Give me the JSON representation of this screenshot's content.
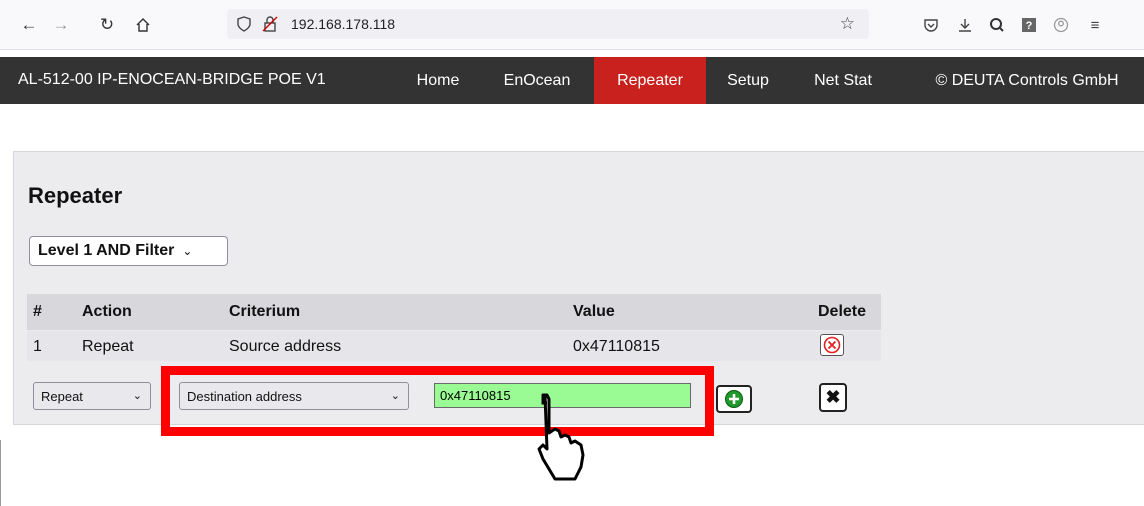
{
  "browser": {
    "url": "192.168.178.118",
    "icons": [
      "back-icon",
      "forward-icon",
      "reload-icon",
      "home-icon",
      "shield-icon",
      "insecure-lock-icon",
      "bookmark-star-icon",
      "pocket-icon",
      "download-icon",
      "extension-icon",
      "help-icon",
      "account-icon",
      "menu-icon"
    ]
  },
  "site_nav": {
    "brand": "AL-512-00 IP-ENOCEAN-BRIDGE POE V1",
    "items": [
      "Home",
      "EnOcean",
      "Repeater",
      "Setup",
      "Net Stat"
    ],
    "active": "Repeater",
    "copyright": "© DEUTA Controls GmbH",
    "active_color": "#c9211e"
  },
  "page": {
    "title": "Repeater",
    "level_select": "Level 1 AND Filter"
  },
  "table": {
    "headers": [
      "#",
      "Action",
      "Criterium",
      "Value",
      "Delete"
    ],
    "rows": [
      {
        "num": "1",
        "action": "Repeat",
        "criterium": "Source address",
        "value": "0x47110815"
      }
    ]
  },
  "form": {
    "action_select": "Repeat",
    "criterium_select": "Destination address",
    "value_input": "0x47110815",
    "input_color": "#9afa93"
  },
  "highlight_color": "#ff0000"
}
